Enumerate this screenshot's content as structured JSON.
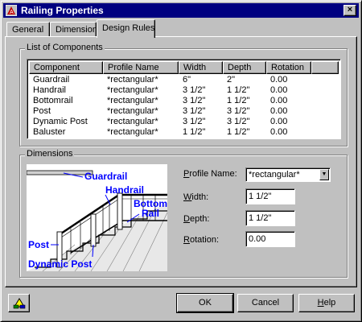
{
  "window": {
    "title": "Railing Properties",
    "close_glyph": "×"
  },
  "tabs": [
    {
      "label": "General",
      "active": false
    },
    {
      "label": "Dimensions",
      "active": false
    },
    {
      "label": "Design Rules",
      "active": true
    }
  ],
  "components_group": {
    "label": "List of Components",
    "columns": [
      "Component",
      "Profile Name",
      "Width",
      "Depth",
      "Rotation"
    ],
    "rows": [
      [
        "Guardrail",
        "*rectangular*",
        "6\"",
        "2\"",
        "0.00"
      ],
      [
        "Handrail",
        "*rectangular*",
        "3 1/2\"",
        "1 1/2\"",
        "0.00"
      ],
      [
        "Bottomrail",
        "*rectangular*",
        "3 1/2\"",
        "1 1/2\"",
        "0.00"
      ],
      [
        "Post",
        "*rectangular*",
        "3 1/2\"",
        "3 1/2\"",
        "0.00"
      ],
      [
        "Dynamic Post",
        "*rectangular*",
        "3 1/2\"",
        "3 1/2\"",
        "0.00"
      ],
      [
        "Baluster",
        "*rectangular*",
        "1 1/2\"",
        "1 1/2\"",
        "0.00"
      ]
    ]
  },
  "dimensions_group": {
    "label": "Dimensions",
    "illustration_labels": {
      "guardrail": "Guardrail",
      "handrail": "Handrail",
      "bottom_rail_1": "Bottom",
      "bottom_rail_2": "Rail",
      "post": "Post",
      "dynamic_post": "Dynamic Post"
    },
    "profile_label": {
      "mnemonic": "P",
      "rest": "rofile Name:"
    },
    "profile_value": "*rectangular*",
    "width_label": {
      "mnemonic": "W",
      "rest": "idth:"
    },
    "width_value": "1 1/2\"",
    "depth_label": {
      "mnemonic": "D",
      "rest": "epth:"
    },
    "depth_value": "1 1/2\"",
    "rotation_label": {
      "mnemonic": "R",
      "rest": "otation:"
    },
    "rotation_value": "0.00"
  },
  "buttons": {
    "ok": "OK",
    "cancel": "Cancel",
    "help_mnemonic": "H",
    "help_rest": "elp"
  },
  "colors": {
    "titlebar": "#000080",
    "callout_text": "#0000ff"
  },
  "icons": {
    "app": "autocad-app-icon",
    "close": "close-icon",
    "dropdown": "chevron-down-icon",
    "floating_viewer": "floating-viewer-icon"
  }
}
